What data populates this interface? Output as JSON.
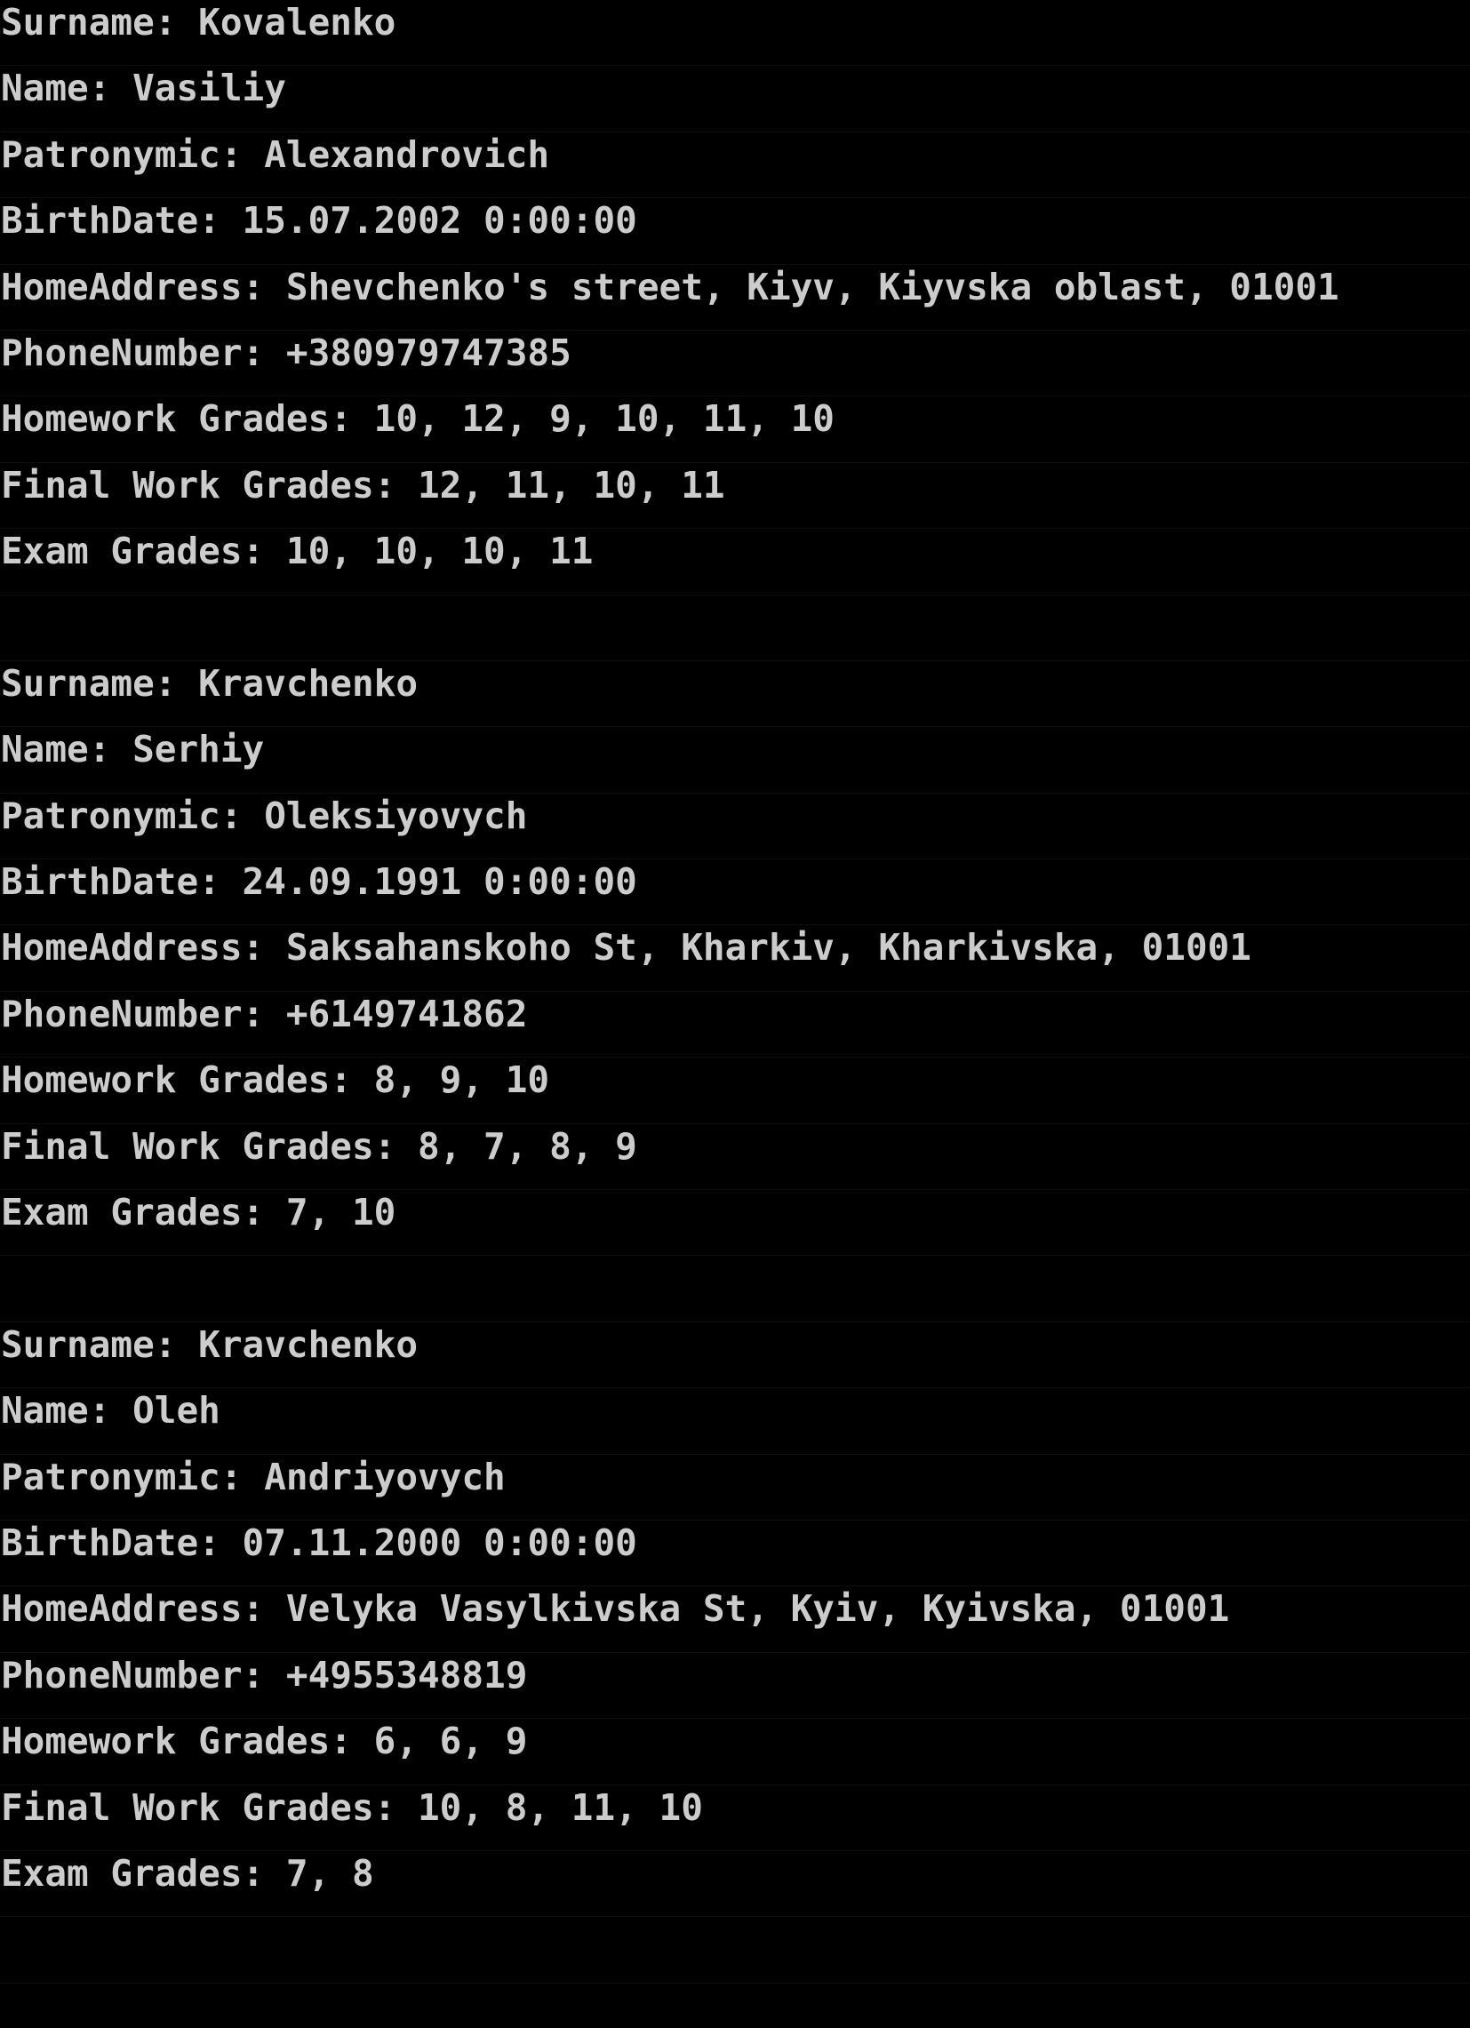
{
  "console": {
    "background": "#000000",
    "text_color": "#cccccc",
    "records": [
      {
        "surname": "Surname: Kovalenko",
        "name": "Name: Vasiliy",
        "patronymic": "Patronymic: Alexandrovich",
        "birth_date": "BirthDate: 15.07.2002 0:00:00",
        "home_address": "HomeAddress: Shevchenko's street, Kiyv, Kiyvska oblast, 01001",
        "phone_number": "PhoneNumber: +380979747385",
        "homework_grades": "Homework Grades: 10, 12, 9, 10, 11, 10",
        "final_work_grades": "Final Work Grades: 12, 11, 10, 11",
        "exam_grades": "Exam Grades: 10, 10, 10, 11"
      },
      {
        "surname": "Surname: Kravchenko",
        "name": "Name: Serhiy",
        "patronymic": "Patronymic: Oleksiyovych",
        "birth_date": "BirthDate: 24.09.1991 0:00:00",
        "home_address": "HomeAddress: Saksahanskoho St, Kharkiv, Kharkivska, 01001",
        "phone_number": "PhoneNumber: +6149741862",
        "homework_grades": "Homework Grades: 8, 9, 10",
        "final_work_grades": "Final Work Grades: 8, 7, 8, 9",
        "exam_grades": "Exam Grades: 7, 10"
      },
      {
        "surname": "Surname: Kravchenko",
        "name": "Name: Oleh",
        "patronymic": "Patronymic: Andriyovych",
        "birth_date": "BirthDate: 07.11.2000 0:00:00",
        "home_address": "HomeAddress: Velyka Vasylkivska St, Kyiv, Kyivska, 01001",
        "phone_number": "PhoneNumber: +4955348819",
        "homework_grades": "Homework Grades: 6, 6, 9",
        "final_work_grades": "Final Work Grades: 10, 8, 11, 10",
        "exam_grades": "Exam Grades: 7, 8"
      }
    ]
  }
}
